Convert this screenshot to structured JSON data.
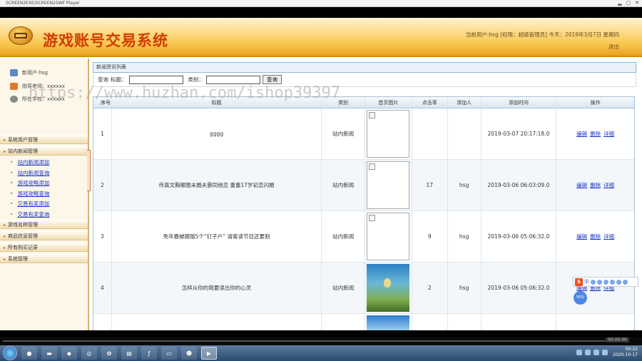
{
  "player": {
    "title": "SCREEN2EXE/SCREEN2SWF Player",
    "min": "▂",
    "restore": "▢",
    "close": "✕"
  },
  "header": {
    "title": "游戏账号交易系统",
    "user_info": "当前用户:hsg [权限：超级管理员] 今天：2019年3月7日 星期四",
    "logout": "退出"
  },
  "profile": {
    "user": "新用户:hsg",
    "teacher": "指导老师：xxxxxx",
    "school": "所在学校：xxxxxx"
  },
  "menu": [
    {
      "label": "系统用户管理",
      "items": []
    },
    {
      "label": "站内新闻管理",
      "items": [
        "站内新闻添加",
        "站内新闻查询",
        "游戏攻略添加",
        "游戏攻略查询",
        "交易有奖添加",
        "交易有奖查询"
      ]
    },
    {
      "label": "游戏名称管理",
      "items": []
    },
    {
      "label": "商品信息管理",
      "items": []
    },
    {
      "label": "所有购买记录",
      "items": []
    },
    {
      "label": "系统管理",
      "items": []
    }
  ],
  "breadcrumb": "新闻资讯列表",
  "search": {
    "query_label": "查询",
    "title_label": "标题：",
    "category_label": "类别：",
    "button": "查询",
    "title_value": "",
    "category_value": ""
  },
  "table": {
    "headers": [
      "序号",
      "标题",
      "类别",
      "首页图片",
      "点击率",
      "添加人",
      "添加时间",
      "操作"
    ],
    "rows": [
      {
        "no": "1",
        "title": "gggg",
        "category": "站内新闻",
        "image": "broken",
        "clicks": "",
        "adder": "",
        "time": "2019-03-07 20:17:18.0"
      },
      {
        "no": "2",
        "title": "传真文胸哪图未婚夫暴同他恋 重重17岁初恋闪婚",
        "category": "站内新闻",
        "image": "broken",
        "clicks": "17",
        "adder": "hsg",
        "time": "2019-03-06 06:03:09.0"
      },
      {
        "no": "3",
        "title": "免年春被跟随5个“钉子户” 请客读节目还要割",
        "category": "站内新闻",
        "image": "broken",
        "clicks": "9",
        "adder": "hsg",
        "time": "2019-03-06 05:06:32.0"
      },
      {
        "no": "4",
        "title": "怎样从你的简要读出你的心灵",
        "category": "站内新闻",
        "image": "balloon",
        "clicks": "2",
        "adder": "hsg",
        "time": "2019-03-06 05:06:32.0"
      }
    ],
    "ops": {
      "edit": "编辑",
      "delete": "删除",
      "detail": "详细"
    }
  },
  "watermark": "https://www.huzhan.com/ishop39397",
  "ime": {
    "label": "中"
  },
  "bubble": "50%",
  "player_time": "00:00:00",
  "tray": {
    "time": "00:22",
    "date": "2020-10-17"
  },
  "colors": {
    "title": "#d23c00",
    "header_gradient_end": "#e8a21d",
    "link": "#1a36c8"
  }
}
